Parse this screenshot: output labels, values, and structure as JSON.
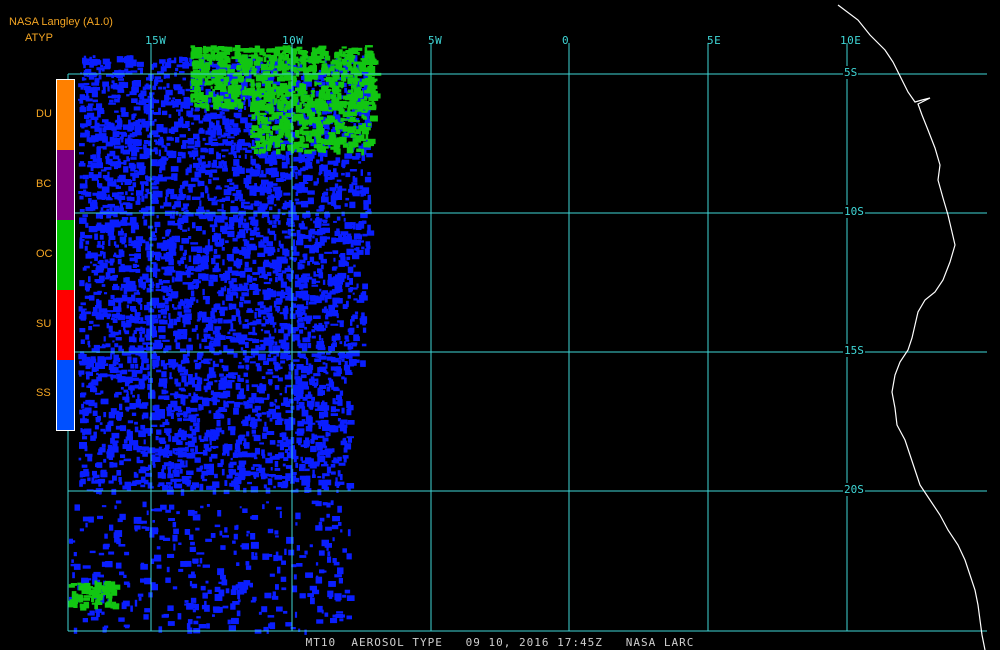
{
  "header": {
    "agency": "NASA Langley (A1.0)",
    "product": "ATYP"
  },
  "legend": [
    {
      "label": "DU",
      "color": "#ff8000"
    },
    {
      "label": "BC",
      "color": "#800080"
    },
    {
      "label": "OC",
      "color": "#00c000"
    },
    {
      "label": "SU",
      "color": "#ff0000"
    },
    {
      "label": "SS",
      "color": "#0050ff"
    }
  ],
  "grid": {
    "color": "#3fd6d6",
    "lon_labels": [
      "15W",
      "10W",
      "5W",
      "0",
      "5E",
      "10E"
    ],
    "lat_labels": [
      "5S",
      "10S",
      "15S",
      "20S"
    ]
  },
  "map": {
    "coastline_color": "#ffffff",
    "background": "#000000",
    "region": "Southeast Atlantic / West Africa coast"
  },
  "caption": "MT10  AEROSOL TYPE   09 10, 2016 17:45Z   NASA LARC"
}
